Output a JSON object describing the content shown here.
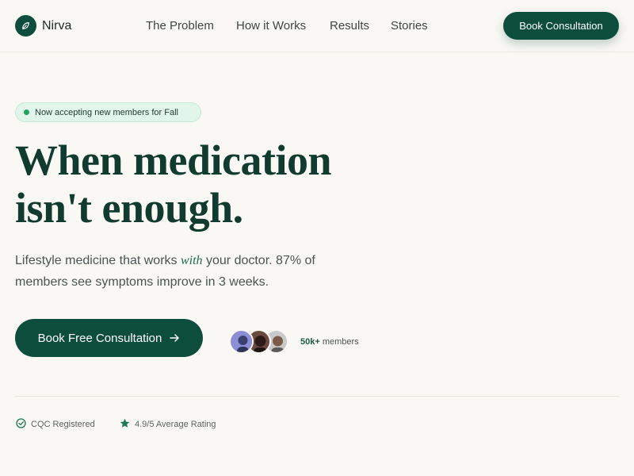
{
  "brand": {
    "name": "Nirva",
    "logo_icon": "leaf-icon",
    "accent": "#0d4d3c"
  },
  "nav": {
    "links": [
      "The Problem",
      "How it Works",
      "Results",
      "Stories"
    ],
    "cta_label": "Book Consultation"
  },
  "hero": {
    "badge": "Now accepting new members for Fall",
    "headline_line1": "When medication",
    "headline_line2": "isn't enough.",
    "sub_part1": "Lifestyle medicine that works ",
    "sub_emphasis": "with",
    "sub_part2": " your doctor. 87% of members see symptoms improve in 3 weeks.",
    "cta_label": "Book Free Consultation",
    "cta_icon": "arrow-right-icon",
    "members_count": "50k+",
    "members_label": " members"
  },
  "trust": [
    {
      "icon": "check-circle-icon",
      "label": "CQC Registered"
    },
    {
      "icon": "star-icon",
      "label": "4.9/5 Average Rating"
    }
  ]
}
